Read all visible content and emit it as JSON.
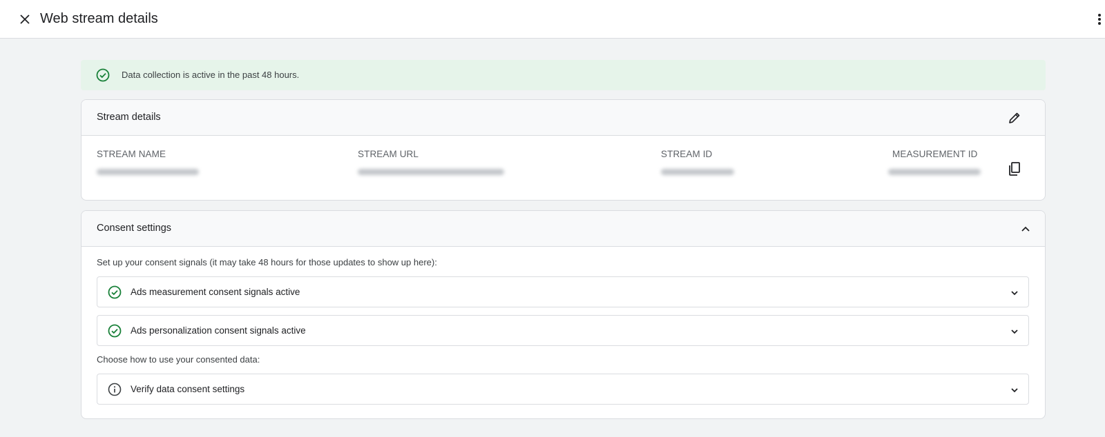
{
  "header": {
    "title": "Web stream details",
    "close_icon": "close-icon",
    "more_icon": "more-vert-icon"
  },
  "banner": {
    "text": "Data collection is active in the past 48 hours.",
    "icon": "check-circle-icon",
    "color": "#188038",
    "background": "#e6f4ea"
  },
  "stream_details": {
    "title": "Stream details",
    "edit_icon": "pencil-icon",
    "fields": [
      {
        "label": "STREAM NAME"
      },
      {
        "label": "STREAM URL"
      },
      {
        "label": "STREAM ID"
      },
      {
        "label": "MEASUREMENT ID"
      }
    ],
    "copy_icon": "copy-icon"
  },
  "consent": {
    "title": "Consent settings",
    "collapse_icon": "chevron-up-icon",
    "intro": "Set up your consent signals (it may take 48 hours for those updates to show up here):",
    "items": [
      {
        "label": "Ads measurement consent signals active",
        "icon": "check-circle-icon"
      },
      {
        "label": "Ads personalization consent signals active",
        "icon": "check-circle-icon"
      }
    ],
    "use_text": "Choose how to use your consented data:",
    "verify": {
      "label": "Verify data consent settings",
      "icon": "info-icon"
    }
  }
}
